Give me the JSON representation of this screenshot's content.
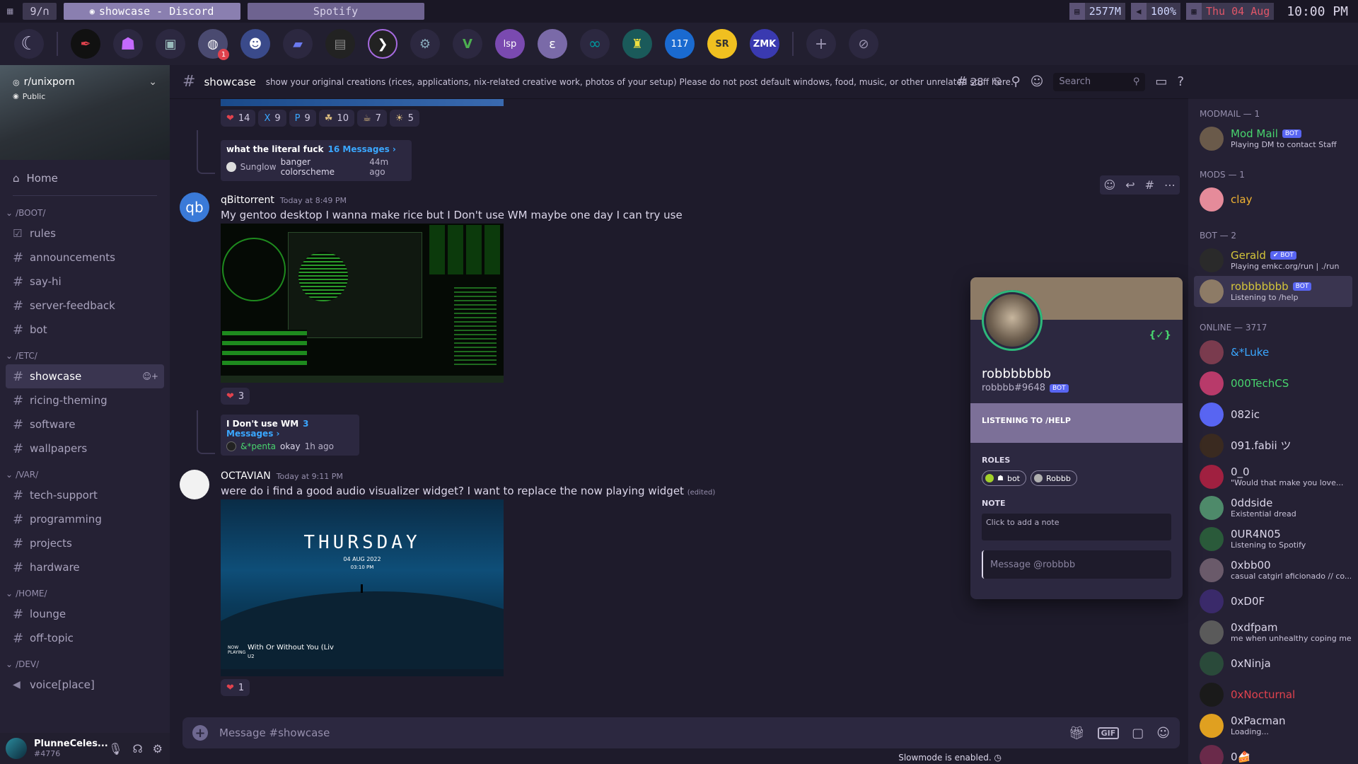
{
  "wmbar": {
    "workspace": "9/∩",
    "windows": [
      {
        "label": "showcase - Discord",
        "active": true
      },
      {
        "label": "Spotify",
        "active": false
      }
    ],
    "memory": "2577M",
    "volume": "100%",
    "date": "Thu 04 Aug",
    "clock": "10:00 PM"
  },
  "guilds": {
    "icons": [
      "moon-logo-icon",
      "feather-icon",
      "ghost-icon",
      "computer-icon",
      "globe-icon",
      "people-icon",
      "folder-icon",
      "terminal-block-icon",
      "terminal-prompt-icon",
      "gear-cloud-icon",
      "vim-icon",
      "lsp-icon",
      "emacs-icon",
      "arduino-icon",
      "lantern-icon",
      "number-icon",
      "sr-logo-icon",
      "zmk-icon",
      "add-server-icon",
      "explore-icon"
    ],
    "badge": "1",
    "zmk_label": "ZMK"
  },
  "server": {
    "name": "r/unixporn",
    "visibility": "Public"
  },
  "sidebar": {
    "home": "Home",
    "categories": [
      {
        "name": "/BOOT/",
        "channels": [
          "rules",
          "announcements",
          "say-hi",
          "server-feedback",
          "bot"
        ]
      },
      {
        "name": "/ETC/",
        "channels": [
          "showcase",
          "ricing-theming",
          "software",
          "wallpapers"
        ]
      },
      {
        "name": "/VAR/",
        "channels": [
          "tech-support",
          "programming",
          "projects",
          "hardware"
        ]
      },
      {
        "name": "/HOME/",
        "channels": [
          "lounge",
          "off-topic"
        ]
      },
      {
        "name": "/DEV/",
        "channels": [
          "voice[place]"
        ]
      }
    ],
    "selected": "showcase"
  },
  "user": {
    "name": "PlunneCeles...",
    "tag": "#4776"
  },
  "header": {
    "channel": "showcase",
    "topic": "show your original creations (rices, applications, nix-related creative work, photos of your setup) Please do not post default windows, food, music, or other unrelated stuff here.",
    "thread_count": "28",
    "search_placeholder": "Search"
  },
  "chat": {
    "top_reactions": [
      {
        "emoji": "❤",
        "count": "14"
      },
      {
        "emoji": "X",
        "count": "9"
      },
      {
        "emoji": "P",
        "count": "9"
      },
      {
        "emoji": "☘",
        "count": "10"
      },
      {
        "emoji": "☕",
        "count": "7"
      },
      {
        "emoji": "☀",
        "count": "5"
      }
    ],
    "thread1": {
      "title": "what the literal fuck",
      "count": "16 Messages ›",
      "last_user": "Sunglow",
      "last_text": "banger colorscheme",
      "time": "44m ago"
    },
    "msg1": {
      "author": "qBittorrent",
      "time": "Today at 8:49 PM",
      "text": "My gentoo desktop I wanna make rice but I Don't use WM maybe one day I can try use",
      "reaction": "3"
    },
    "thread2": {
      "title": "I Don't use WM",
      "count": "3 Messages ›",
      "last_user": "&*penta",
      "last_text": "okay",
      "time": "1h ago"
    },
    "msg2": {
      "author": "OCTAVIAN",
      "time": "Today at 9:11 PM",
      "text": "were do i find a good audio visualizer widget? I want to replace the now playing widget",
      "edited": "(edited)",
      "reaction": "1",
      "img_title": "THURSDAY",
      "img_date": "04 AUG 2022",
      "img_time": "03:10 PM",
      "img_song": "With Or Without You (Liv",
      "img_np": "NOW PLAYING",
      "img_artist": "U2"
    },
    "composer_placeholder": "Message #showcase",
    "slowmode": "Slowmode is enabled."
  },
  "members": {
    "sections": [
      {
        "title": "MODMAIL — 1",
        "items": [
          {
            "name": "Mod Mail",
            "bot": "BOT",
            "status": "Playing DM to contact Staff",
            "color": "#48d56e",
            "av": "#6a5a4a"
          }
        ]
      },
      {
        "title": "MODS — 1",
        "items": [
          {
            "name": "clay",
            "status": "",
            "color": "#f0b232",
            "av": "#e58b9a"
          }
        ]
      },
      {
        "title": "BOT — 2",
        "items": [
          {
            "name": "Gerald",
            "bot": "✔ BOT",
            "status": "Playing emkc.org/run | ./run",
            "color": "#d4c53a",
            "av": "#2a2a2a"
          },
          {
            "name": "robbbbbbb",
            "bot": "BOT",
            "status": "Listening to /help",
            "color": "#d4c53a",
            "av": "#8d7b66"
          }
        ]
      },
      {
        "title": "ONLINE — 3717",
        "items": [
          {
            "name": "&*Luke",
            "status": "",
            "color": "#3aa7ff",
            "av": "#7a3b4e"
          },
          {
            "name": "000TechCS",
            "status": "",
            "color": "#48d56e",
            "av": "#b83a6a"
          },
          {
            "name": "082ic",
            "status": "",
            "color": "#dcd7ea",
            "av": "#5865f2"
          },
          {
            "name": "091.fabii ツ",
            "status": "",
            "color": "#dcd7ea",
            "av": "#3a2a20"
          },
          {
            "name": "0_0",
            "status": "\"Would that make you love...",
            "color": "#dcd7ea",
            "av": "#a02040"
          },
          {
            "name": "0ddside",
            "status": "Existential dread",
            "color": "#dcd7ea",
            "av": "#4e8a6a"
          },
          {
            "name": "0UR4N05",
            "status": "Listening to Spotify",
            "color": "#dcd7ea",
            "av": "#2a5a3a"
          },
          {
            "name": "0xbb00",
            "status": "casual catgirl aficionado // co...",
            "color": "#dcd7ea",
            "av": "#6a5a6a"
          },
          {
            "name": "0xD0F",
            "status": "",
            "color": "#dcd7ea",
            "av": "#3a2a6a"
          },
          {
            "name": "0xdfpam",
            "status": "me when unhealthy coping me...",
            "color": "#dcd7ea",
            "av": "#5a5a5a"
          },
          {
            "name": "0xNinja",
            "status": "",
            "color": "#dcd7ea",
            "av": "#2a4a3a"
          },
          {
            "name": "0xNocturnal",
            "status": "",
            "color": "#e0424d",
            "av": "#1a1a1a"
          },
          {
            "name": "0xPacman",
            "status": "Loading...",
            "color": "#dcd7ea",
            "av": "#e0a020"
          },
          {
            "name": "0🍰",
            "status": "",
            "color": "#dcd7ea",
            "av": "#6a2a4a"
          }
        ]
      }
    ]
  },
  "popout": {
    "name": "robbbbbbb",
    "tag": "robbbb#9648",
    "bot": "BOT",
    "code_icon": "{✓}",
    "activity": "LISTENING TO /HELP",
    "roles_label": "ROLES",
    "roles": [
      {
        "name": "bot",
        "color": "#a3d12a"
      },
      {
        "name": "Robbb",
        "color": "#b0b0b0"
      }
    ],
    "note_label": "NOTE",
    "note_placeholder": "Click to add a note",
    "message_placeholder": "Message @robbbb"
  }
}
